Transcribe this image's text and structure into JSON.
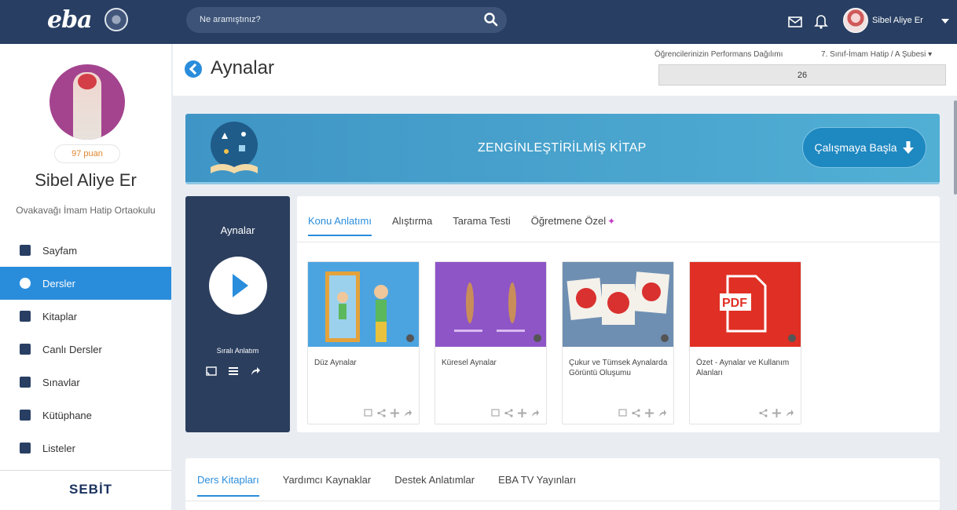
{
  "topbar": {
    "logo": "eba",
    "search_placeholder": "Ne aramıştınız?",
    "user_name": "Sibel Aliye Er"
  },
  "sidebar": {
    "points": "97 puan",
    "name": "Sibel Aliye Er",
    "school": "Ovakavağı İmam Hatip Ortaokulu",
    "items": [
      {
        "label": "Sayfam",
        "icon": "person-icon"
      },
      {
        "label": "Dersler",
        "icon": "play-circle-icon",
        "active": true
      },
      {
        "label": "Kitaplar",
        "icon": "book-icon"
      },
      {
        "label": "Canlı Dersler",
        "icon": "video-camera-icon"
      },
      {
        "label": "Sınavlar",
        "icon": "pencil-icon"
      },
      {
        "label": "Kütüphane",
        "icon": "library-icon"
      },
      {
        "label": "Listeler",
        "icon": "list-icon"
      }
    ],
    "footer_brand": "SEBİT"
  },
  "header": {
    "title": "Aynalar",
    "performance_label": "Öğrencilerinizin Performans Dağılımı",
    "class_selector": "7. Sınıf-İmam Hatip / A Şubesi ▾",
    "performance_value": "26"
  },
  "banner": {
    "title": "ZENGİNLEŞTİRİLMİŞ KİTAP",
    "button_label": "Çalışmaya Başla"
  },
  "play_panel": {
    "title": "Aynalar",
    "subtitle": "Sıralı Anlatım"
  },
  "content": {
    "tabs": [
      "Konu Anlatımı",
      "Alıştırma",
      "Tarama Testi",
      "Öğretmene Özel"
    ],
    "active_tab": 0,
    "items": [
      {
        "title": "Düz Aynalar",
        "thumb": "mirror-boy"
      },
      {
        "title": "Küresel Aynalar",
        "thumb": "spherical-mirrors"
      },
      {
        "title": "Çukur ve Tümsek Aynalarda Görüntü Oluşumu",
        "thumb": "red-figures"
      },
      {
        "title": "Özet - Aynalar ve Kullanım Alanları",
        "thumb": "pdf"
      }
    ]
  },
  "bottom": {
    "tabs": [
      "Ders Kitapları",
      "Yardımcı Kaynaklar",
      "Destek Anlatımlar",
      "EBA TV Yayınları"
    ],
    "active_tab": 0
  },
  "colors": {
    "topbar": "#283f63",
    "accent": "#2a8ddc",
    "panel": "#2b3e5e",
    "banner": "#47a2cc"
  }
}
